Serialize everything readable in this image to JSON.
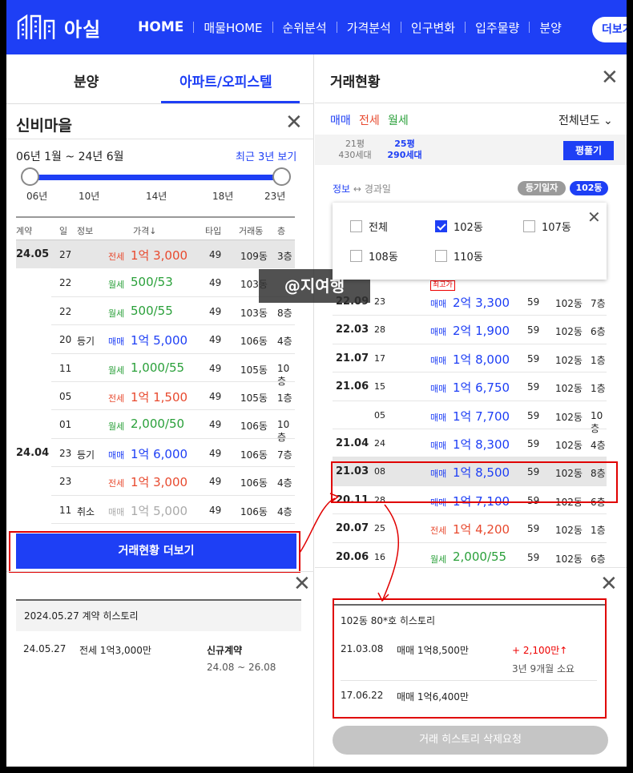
{
  "nav": {
    "logo_text": "아실",
    "links": [
      "HOME",
      "매물HOME",
      "순위분석",
      "가격분석",
      "인구변화",
      "입주물량",
      "분양"
    ],
    "more_button": "더보기"
  },
  "left": {
    "tabs": [
      "분양",
      "아파트/오피스텔"
    ],
    "complex_name": "신비마을",
    "period": "06년 1월 ~ 24년 6월",
    "recent_link": "최근 3년 보기",
    "slider_ticks": [
      "06년",
      "10년",
      "14년",
      "18년",
      "23년"
    ],
    "headers": [
      "계약",
      "일",
      "정보",
      "가격↓",
      "타입",
      "거래동",
      "층"
    ],
    "rows": [
      {
        "month": "24.05",
        "day": "27",
        "info": "",
        "type": "전세",
        "price": "1억 3,000",
        "tp": "49",
        "dong": "109동",
        "floor": "3층",
        "color": "red",
        "highlight": true
      },
      {
        "month": "",
        "day": "22",
        "info": "",
        "type": "월세",
        "price": "500/53",
        "tp": "49",
        "dong": "103동",
        "floor": "",
        "color": "green"
      },
      {
        "month": "",
        "day": "22",
        "info": "",
        "type": "월세",
        "price": "500/55",
        "tp": "49",
        "dong": "103동",
        "floor": "8층",
        "color": "green"
      },
      {
        "month": "",
        "day": "20",
        "info": "등기",
        "type": "매매",
        "price": "1억 5,000",
        "tp": "49",
        "dong": "106동",
        "floor": "4층",
        "color": "blue"
      },
      {
        "month": "",
        "day": "11",
        "info": "",
        "type": "월세",
        "price": "1,000/55",
        "tp": "49",
        "dong": "105동",
        "floor": "10층",
        "color": "green"
      },
      {
        "month": "",
        "day": "05",
        "info": "",
        "type": "전세",
        "price": "1억 1,500",
        "tp": "49",
        "dong": "105동",
        "floor": "1층",
        "color": "red"
      },
      {
        "month": "",
        "day": "01",
        "info": "",
        "type": "월세",
        "price": "2,000/50",
        "tp": "49",
        "dong": "106동",
        "floor": "10층",
        "color": "green"
      },
      {
        "month": "24.04",
        "day": "23",
        "info": "등기",
        "type": "매매",
        "price": "1억 6,000",
        "tp": "49",
        "dong": "106동",
        "floor": "7층",
        "color": "blue"
      },
      {
        "month": "",
        "day": "23",
        "info": "",
        "type": "전세",
        "price": "1억 3,000",
        "tp": "49",
        "dong": "106동",
        "floor": "4층",
        "color": "red"
      },
      {
        "month": "",
        "day": "11",
        "info": "취소",
        "type": "매매",
        "price": "1억 5,000",
        "tp": "49",
        "dong": "106동",
        "floor": "4층",
        "color": "gray"
      }
    ],
    "more_button": "거래현황 더보기",
    "history_title": "2024.05.27 계약 히스토리",
    "history": {
      "date": "24.05.27",
      "deal": "전세 1억3,000만",
      "kind": "신규계약",
      "period": "24.08 ~ 26.08"
    }
  },
  "watermark": "@지여행",
  "right": {
    "title": "거래현황",
    "types": [
      {
        "label": "매매",
        "color": "#1e3ff5"
      },
      {
        "label": "전세",
        "color": "#e84a2f"
      },
      {
        "label": "월세",
        "color": "#2aa03a"
      }
    ],
    "year_select": "전체년도",
    "areas": [
      {
        "size": "21평",
        "units": "430세대"
      },
      {
        "size": "25평",
        "units": "290세대"
      }
    ],
    "pyung_button": "평풀기",
    "info_label": "정보",
    "info_arrow": "↔",
    "info_alt": "경과일",
    "pill_registry": "등기일자",
    "pill_dong": "102동",
    "dong_options": [
      {
        "label": "전체",
        "checked": false
      },
      {
        "label": "102동",
        "checked": true
      },
      {
        "label": "107동",
        "checked": false
      },
      {
        "label": "108동",
        "checked": false
      },
      {
        "label": "110동",
        "checked": false
      }
    ],
    "max_tag": "최고가",
    "rows": [
      {
        "month": "22.09",
        "day": "23",
        "type": "매매",
        "price": "2억 3,300",
        "tp": "59",
        "dong": "102동",
        "floor": "7층",
        "color": "blue",
        "max": true
      },
      {
        "month": "22.03",
        "day": "28",
        "type": "매매",
        "price": "2억 1,900",
        "tp": "59",
        "dong": "102동",
        "floor": "6층",
        "color": "blue"
      },
      {
        "month": "21.07",
        "day": "17",
        "type": "매매",
        "price": "1억 8,000",
        "tp": "59",
        "dong": "102동",
        "floor": "1층",
        "color": "blue"
      },
      {
        "month": "21.06",
        "day": "15",
        "type": "매매",
        "price": "1억 6,750",
        "tp": "59",
        "dong": "102동",
        "floor": "1층",
        "color": "blue"
      },
      {
        "month": "",
        "day": "05",
        "type": "매매",
        "price": "1억 7,700",
        "tp": "59",
        "dong": "102동",
        "floor": "10층",
        "color": "blue"
      },
      {
        "month": "21.04",
        "day": "24",
        "type": "매매",
        "price": "1억 8,300",
        "tp": "59",
        "dong": "102동",
        "floor": "4층",
        "color": "blue"
      },
      {
        "month": "21.03",
        "day": "08",
        "type": "매매",
        "price": "1억 8,500",
        "tp": "59",
        "dong": "102동",
        "floor": "8층",
        "color": "blue",
        "highlight": true
      },
      {
        "month": "20.11",
        "day": "28",
        "type": "매매",
        "price": "1억 7,100",
        "tp": "59",
        "dong": "102동",
        "floor": "6층",
        "color": "blue"
      },
      {
        "month": "20.07",
        "day": "25",
        "type": "전세",
        "price": "1억 4,200",
        "tp": "59",
        "dong": "102동",
        "floor": "1층",
        "color": "red"
      },
      {
        "month": "20.06",
        "day": "16",
        "type": "월세",
        "price": "2,000/55",
        "tp": "59",
        "dong": "102동",
        "floor": "6층",
        "color": "green"
      }
    ],
    "history_title": "102동 80*호 히스토리",
    "history": [
      {
        "date": "21.03.08",
        "deal": "매매 1억8,500만",
        "change": "+ 2,100만↑",
        "elapsed": "3년 9개월 소요"
      },
      {
        "date": "17.06.22",
        "deal": "매매 1억6,400만"
      }
    ],
    "delete_button": "거래 히스토리 삭제요청"
  }
}
